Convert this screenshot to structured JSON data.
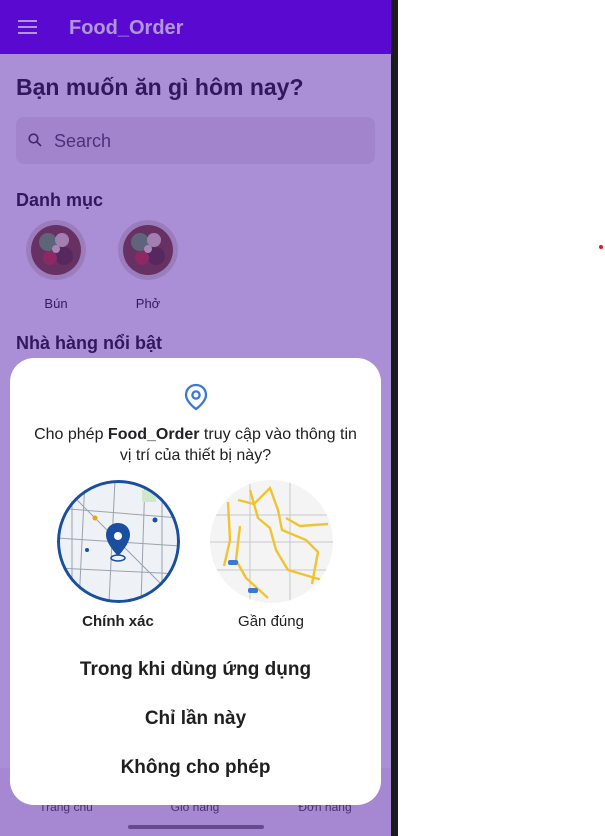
{
  "app": {
    "title": "Food_Order"
  },
  "home": {
    "headline": "Bạn muốn ăn gì hôm nay?",
    "search": {
      "placeholder": "Search"
    },
    "categories_title": "Danh mục",
    "categories": [
      {
        "label": "Bún"
      },
      {
        "label": "Phở"
      }
    ],
    "featured_title": "Nhà hàng nổi bật"
  },
  "bottom_nav": [
    {
      "label": "Trang chủ",
      "icon": "home-icon"
    },
    {
      "label": "Giỏ hàng",
      "icon": "cart-icon"
    },
    {
      "label": "Đơn hàng",
      "icon": "orders-icon"
    }
  ],
  "permission_dialog": {
    "icon": "location-pin-icon",
    "text_prefix": "Cho phép ",
    "app_name": "Food_Order",
    "text_suffix": " truy cập vào thông tin vị trí của thiết bị này?",
    "precise_label": "Chính xác",
    "approx_label": "Gần đúng",
    "options": {
      "while_using": "Trong khi dùng ứng dụng",
      "only_this_time": "Chỉ lần này",
      "deny": "Không cho phép"
    }
  },
  "colors": {
    "app_bar": "#6200ee",
    "scrim": "#8a6ccf",
    "accent": "#1a4fa0"
  }
}
